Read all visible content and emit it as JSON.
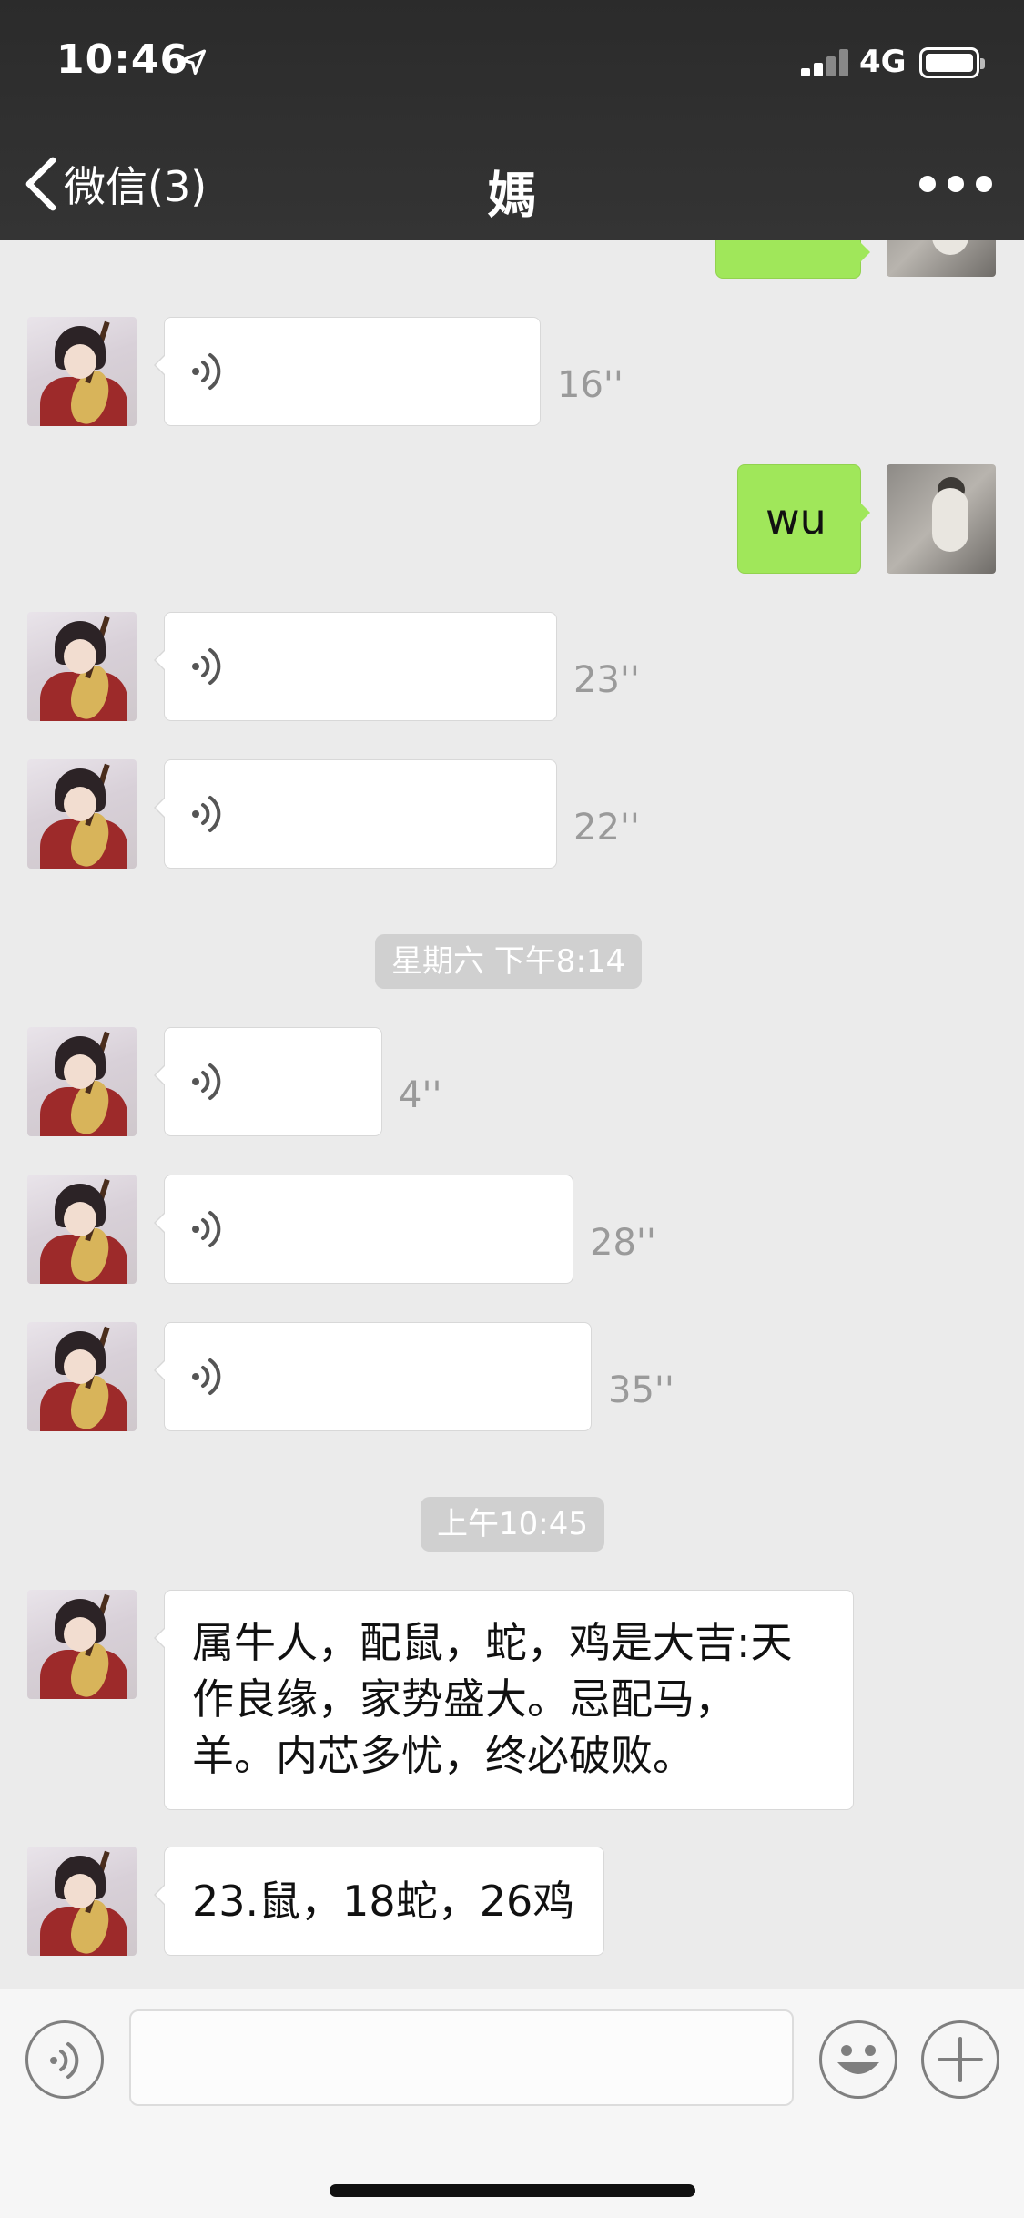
{
  "status_bar": {
    "time": "10:46",
    "network": "4G"
  },
  "nav": {
    "back_label": "微信(3)",
    "title": "媽"
  },
  "messages": [
    {
      "kind": "voice",
      "duration": "16''"
    },
    {
      "kind": "text_out",
      "text": "wu"
    },
    {
      "kind": "voice",
      "duration": "23''"
    },
    {
      "kind": "voice",
      "duration": "22''"
    },
    {
      "kind": "timestamp",
      "text": "星期六 下午8:14"
    },
    {
      "kind": "voice",
      "duration": "4''"
    },
    {
      "kind": "voice",
      "duration": "28''"
    },
    {
      "kind": "voice",
      "duration": "35''"
    },
    {
      "kind": "timestamp",
      "text": "上午10:45"
    },
    {
      "kind": "text_in",
      "lines": [
        "属牛人，配鼠，蛇，鸡是大吉:天",
        "作良缘，家势盛大。忌配马，",
        "羊。内芯多忧，终必破败。"
      ]
    },
    {
      "kind": "text_in",
      "text": "23.鼠，18蛇，26鸡"
    }
  ],
  "input_bar": {
    "voice_icon": "voice-input-icon",
    "emoji_icon": "emoji-icon",
    "plus_icon": "plus-icon",
    "input_value": ""
  },
  "colors": {
    "header_bg": "#2f2f2f",
    "chat_bg": "#ebebeb",
    "outgoing_bubble": "#a0e75a",
    "incoming_bubble": "#ffffff",
    "timestamp_bg": "#d0d0d0"
  }
}
